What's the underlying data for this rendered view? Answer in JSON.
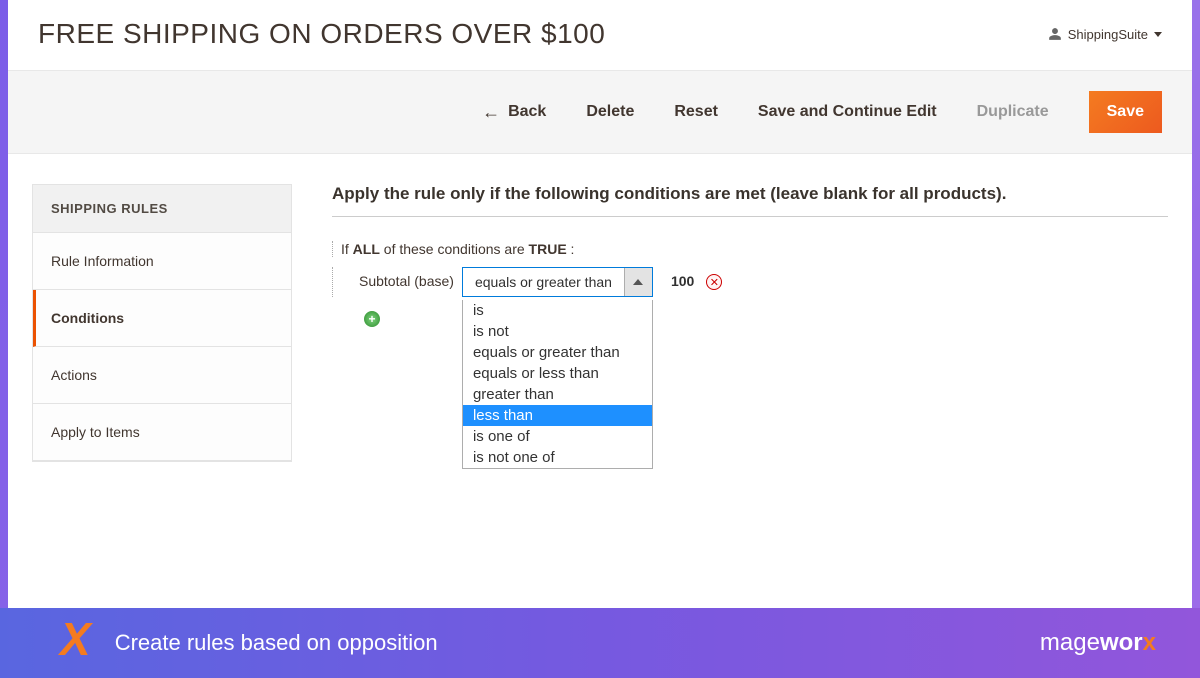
{
  "header": {
    "title": "FREE SHIPPING ON ORDERS OVER $100",
    "user_label": "ShippingSuite"
  },
  "toolbar": {
    "back": "Back",
    "delete": "Delete",
    "reset": "Reset",
    "save_continue": "Save and Continue Edit",
    "duplicate": "Duplicate",
    "save": "Save"
  },
  "sidebar": {
    "header": "SHIPPING RULES",
    "items": [
      {
        "label": "Rule Information",
        "active": false
      },
      {
        "label": "Conditions",
        "active": true
      },
      {
        "label": "Actions",
        "active": false
      },
      {
        "label": "Apply to Items",
        "active": false
      }
    ]
  },
  "conditions": {
    "section_title": "Apply the rule only if the following conditions are met (leave blank for all products).",
    "prefix_if": "If ",
    "all": "ALL",
    "mid": " of these conditions are ",
    "true": "TRUE",
    "colon": " :",
    "attribute": "Subtotal (base)",
    "selected_operator": "equals or greater than",
    "value": "100",
    "operator_options": [
      "is",
      "is not",
      "equals or greater than",
      "equals or less than",
      "greater than",
      "less than",
      "is one of",
      "is not one of"
    ],
    "highlighted_index": 5
  },
  "footer": {
    "text": "Create rules based on opposition",
    "brand_prefix": "mage",
    "brand_bold": "wor",
    "brand_x": "x"
  }
}
